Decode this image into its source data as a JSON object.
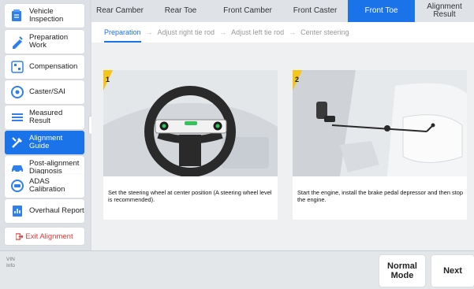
{
  "sidebar": {
    "items": [
      {
        "label": "Vehicle Inspection",
        "icon": "vehicle-inspection-icon"
      },
      {
        "label": "Preparation Work",
        "icon": "preparation-icon"
      },
      {
        "label": "Compensation",
        "icon": "compensation-icon"
      },
      {
        "label": "Caster/SAI",
        "icon": "caster-sai-icon"
      },
      {
        "label": "Measured Result",
        "icon": "measured-result-icon"
      },
      {
        "label": "Alignment Guide",
        "icon": "alignment-guide-icon"
      },
      {
        "label": "Post-alignment Diagnosis",
        "icon": "post-alignment-icon"
      },
      {
        "label": "ADAS Calibration",
        "icon": "adas-icon"
      },
      {
        "label": "Overhaul Report",
        "icon": "overhaul-report-icon"
      }
    ],
    "active_index": 5,
    "exit_label": "Exit Alignment"
  },
  "tabs": [
    {
      "label": "Rear Camber"
    },
    {
      "label": "Rear Toe"
    },
    {
      "label": "Front Camber"
    },
    {
      "label": "Front Caster"
    },
    {
      "label": "Front Toe"
    },
    {
      "label": "Alignment Result"
    }
  ],
  "active_tab": "Front Toe",
  "steps": [
    {
      "label": "Preparation"
    },
    {
      "label": "Adjust right tie rod"
    },
    {
      "label": "Adjust left tie rod"
    },
    {
      "label": "Center steering"
    }
  ],
  "cards": [
    {
      "number": "1",
      "text": "Set the steering wheel at center position (A steering wheel level is recommended)."
    },
    {
      "number": "2",
      "text": "Start the engine, install the brake pedal depressor and then stop the engine."
    }
  ],
  "bottom": {
    "vin_label": "VIN",
    "info_label": "Info",
    "normal_mode_label": "Normal Mode",
    "next_label": "Next"
  },
  "colors": {
    "accent": "#1a73e8",
    "exit": "#e53935",
    "card_number": "#f5c518"
  }
}
